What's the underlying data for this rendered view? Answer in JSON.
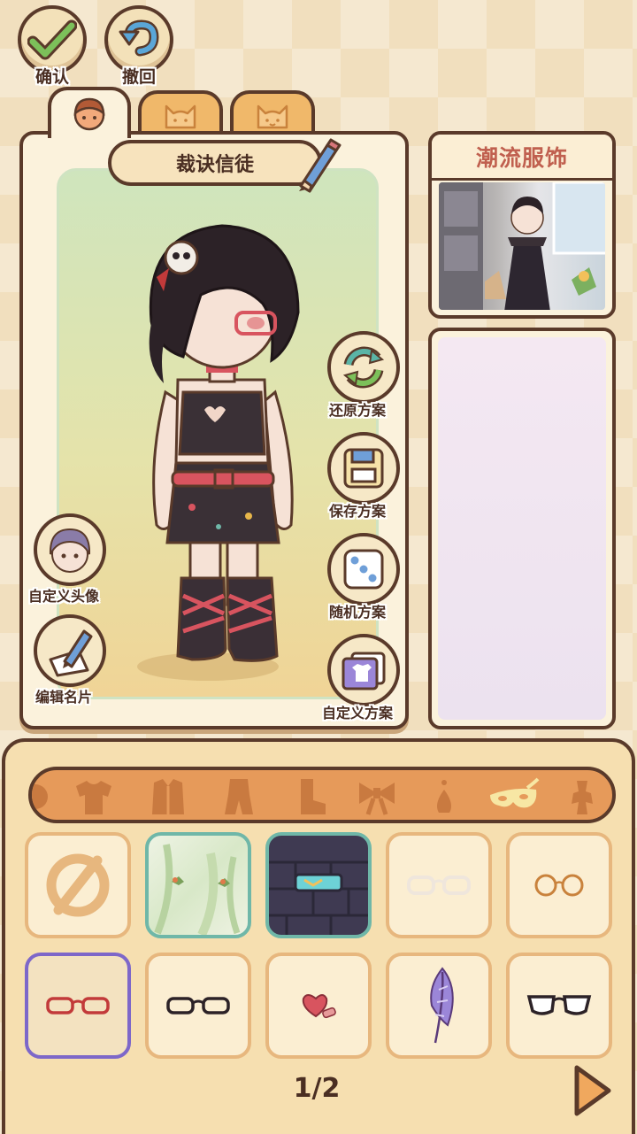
{
  "top_buttons": {
    "confirm_label": "确认",
    "undo_label": "撤回"
  },
  "tabs": [
    {
      "icon": "girl-face-icon",
      "active": true
    },
    {
      "icon": "cat-outline-icon",
      "active": false
    },
    {
      "icon": "cat-face-icon",
      "active": false
    }
  ],
  "character": {
    "name": "裁诀信徒"
  },
  "left_actions": {
    "custom_avatar_label": "自定义头像",
    "edit_card_label": "编辑名片"
  },
  "right_actions": {
    "restore_label": "还原方案",
    "save_label": "保存方案",
    "random_label": "随机方案",
    "custom_label": "自定义方案"
  },
  "style_card": {
    "title": "潮流服饰"
  },
  "categories": [
    {
      "icon": "partial-icon",
      "active": false
    },
    {
      "icon": "top-icon",
      "active": false
    },
    {
      "icon": "coat-icon",
      "active": false
    },
    {
      "icon": "outfit-icon",
      "active": false
    },
    {
      "icon": "sock-icon",
      "active": false
    },
    {
      "icon": "bow-icon",
      "active": false
    },
    {
      "icon": "earring-icon",
      "active": false
    },
    {
      "icon": "mask-icon",
      "active": true
    },
    {
      "icon": "accessory-icon",
      "active": false
    }
  ],
  "items": [
    {
      "name": "none-item",
      "icon": "prohibited-icon"
    },
    {
      "name": "background-green-leaves"
    },
    {
      "name": "background-dark-brick-goggles"
    },
    {
      "name": "white-glasses"
    },
    {
      "name": "round-glasses"
    },
    {
      "name": "red-glasses",
      "selected": true
    },
    {
      "name": "black-glasses"
    },
    {
      "name": "heart-sticker"
    },
    {
      "name": "feather-butterfly"
    },
    {
      "name": "black-white-glasses"
    }
  ],
  "pagination": {
    "text": "1/2"
  },
  "colors": {
    "outline": "#5a3a2a",
    "panel": "#fbf2dc",
    "selected": "#7d67c9",
    "accent_title": "#c0604f",
    "active_category": "#f7e7a4"
  }
}
